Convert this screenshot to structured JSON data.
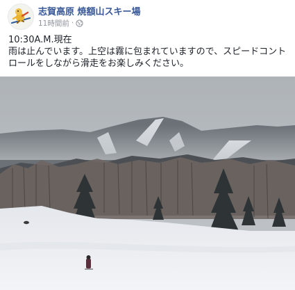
{
  "post": {
    "author": "志賀高原 焼額山スキー場",
    "timestamp": "11時間前",
    "separator": "·",
    "audience_icon": "globe-icon",
    "lines": [
      "10:30A.M.現在",
      "雨は止んでいます。上空は霧に包まれていますので、スピードコント",
      "ロールをしながら滑走をお楽しみください。"
    ]
  },
  "photo": {
    "subject": "foggy-ski-slope-photo"
  },
  "colors": {
    "author_link": "#385898",
    "meta_text": "#90949c",
    "body_text": "#1d2129",
    "fog_sky": "#b7bcc1",
    "snow": "#eef0f3"
  }
}
